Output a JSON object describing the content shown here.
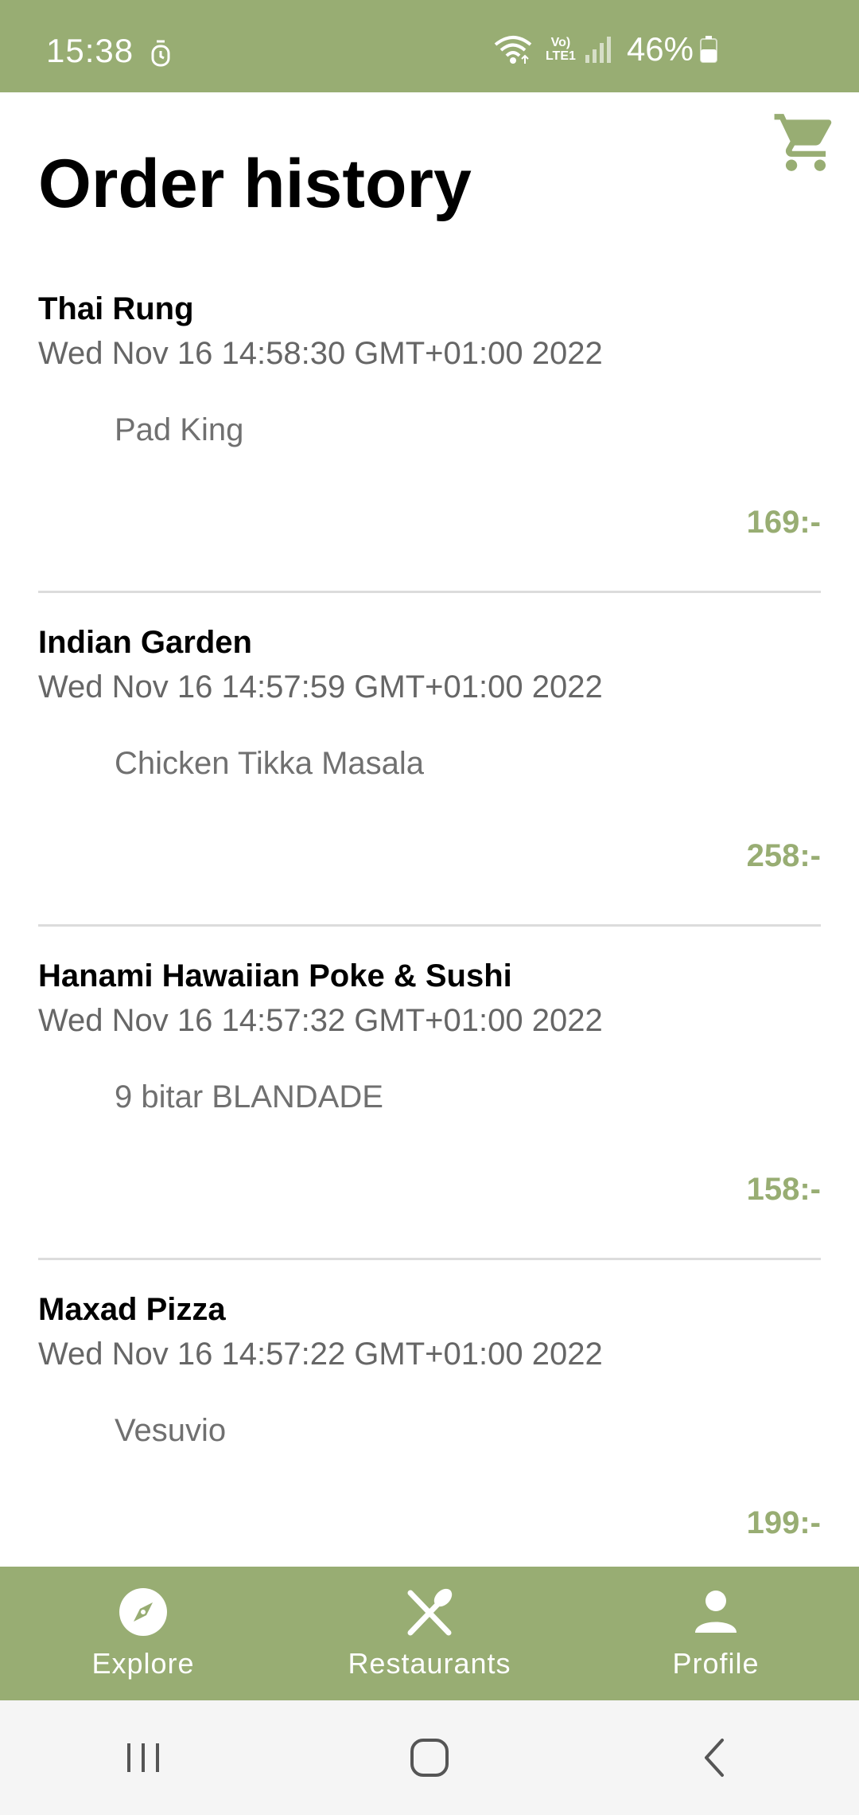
{
  "status_bar": {
    "time": "15:38",
    "network": "Vo) LTE1",
    "battery_percent": "46%",
    "icons": [
      "alarm-icon",
      "wifi-icon",
      "signal-icon",
      "battery-icon"
    ]
  },
  "header": {
    "title": "Order history",
    "cart_icon": "cart-icon"
  },
  "orders": [
    {
      "restaurant": "Thai Rung",
      "date": "Wed Nov 16 14:58:30 GMT+01:00 2022",
      "item": "Pad King",
      "price": "169:-"
    },
    {
      "restaurant": "Indian Garden",
      "date": "Wed Nov 16 14:57:59 GMT+01:00 2022",
      "item": "Chicken Tikka Masala",
      "price": "258:-"
    },
    {
      "restaurant": "Hanami Hawaiian Poke & Sushi",
      "date": "Wed Nov 16 14:57:32 GMT+01:00 2022",
      "item": "9 bitar BLANDADE",
      "price": "158:-"
    },
    {
      "restaurant": "Maxad Pizza",
      "date": "Wed Nov 16 14:57:22 GMT+01:00 2022",
      "item": "Vesuvio",
      "price": "199:-"
    }
  ],
  "bottom_nav": {
    "items": [
      {
        "label": "Explore",
        "icon": "compass-icon"
      },
      {
        "label": "Restaurants",
        "icon": "cutlery-icon"
      },
      {
        "label": "Profile",
        "icon": "person-icon"
      }
    ]
  },
  "colors": {
    "accent": "#98ad73",
    "title_text": "#000000",
    "secondary_text": "#666666",
    "divider": "#dcdcdc",
    "system_nav_bg": "#f5f5f5"
  }
}
